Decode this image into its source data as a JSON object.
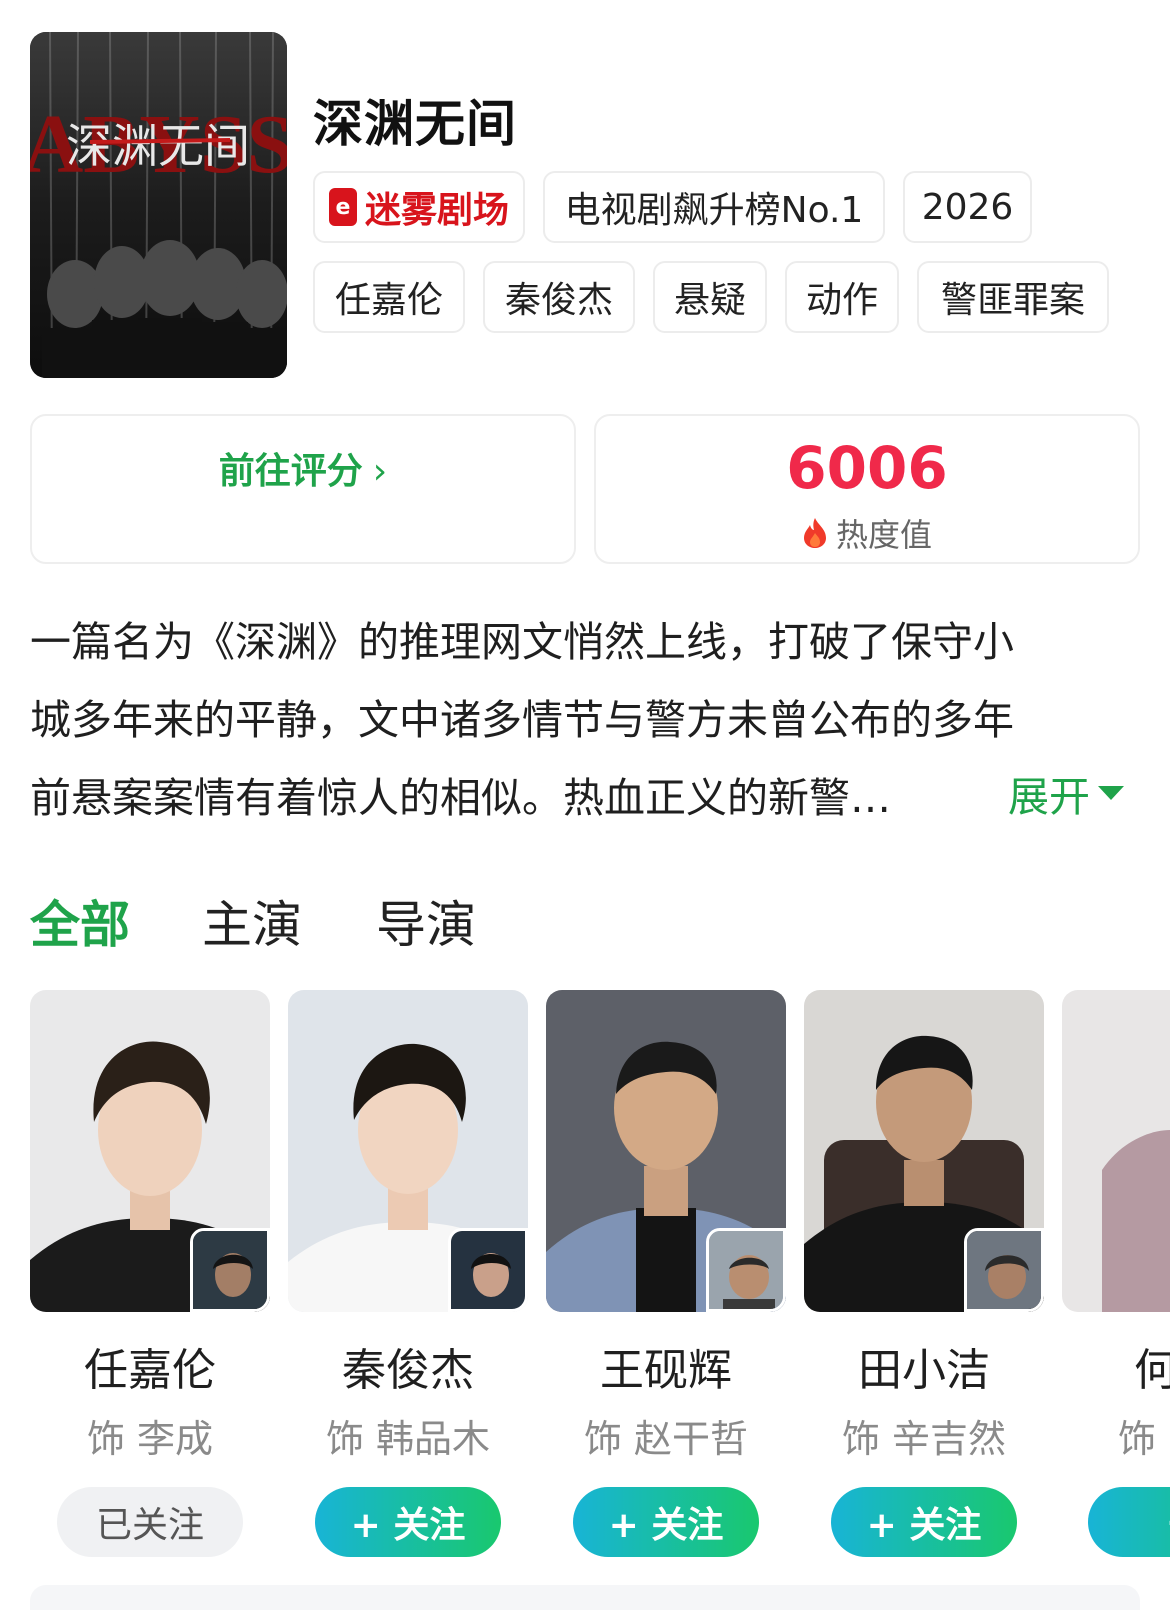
{
  "show": {
    "title": "深渊无间",
    "poster_text": "深渊无间",
    "poster_bg_text": "ABYSS"
  },
  "tags_row1": [
    {
      "label": "迷雾剧场",
      "icon": "mist-theater-logo-icon",
      "color": "#d8141c"
    },
    {
      "label": "电视剧飙升榜No.1"
    },
    {
      "label": "2026"
    }
  ],
  "tags_row2": [
    "任嘉伦",
    "秦俊杰",
    "悬疑",
    "动作",
    "警匪罪案"
  ],
  "rating": {
    "label": "前往评分",
    "chevron": "›"
  },
  "heat": {
    "value": "6006",
    "label": "热度值",
    "icon": "flame-icon"
  },
  "synopsis": {
    "lines": [
      "一篇名为《深渊》的推理网文悄然上线，打破了保守小",
      "城多年来的平静，文中诸多情节与警方未曾公布的多年",
      "前悬案案情有着惊人的相似。热血正义的新警…"
    ],
    "expand_label": "展开"
  },
  "tabs": [
    "全部",
    "主演",
    "导演"
  ],
  "cast": [
    {
      "name": "任嘉伦",
      "role": "饰 李成",
      "follow": "已关注",
      "following": true
    },
    {
      "name": "秦俊杰",
      "role": "饰 韩品木",
      "follow": "+ 关注",
      "following": false
    },
    {
      "name": "王砚辉",
      "role": "饰 赵干哲",
      "follow": "+ 关注",
      "following": false
    },
    {
      "name": "田小洁",
      "role": "饰 辛吉然",
      "follow": "+ 关注",
      "following": false
    },
    {
      "name": "何",
      "role": "饰",
      "follow": "+",
      "following": false
    }
  ],
  "colors": {
    "accent": "#1fa34a",
    "heat": "#f0294a",
    "brand_red": "#d8141c"
  }
}
